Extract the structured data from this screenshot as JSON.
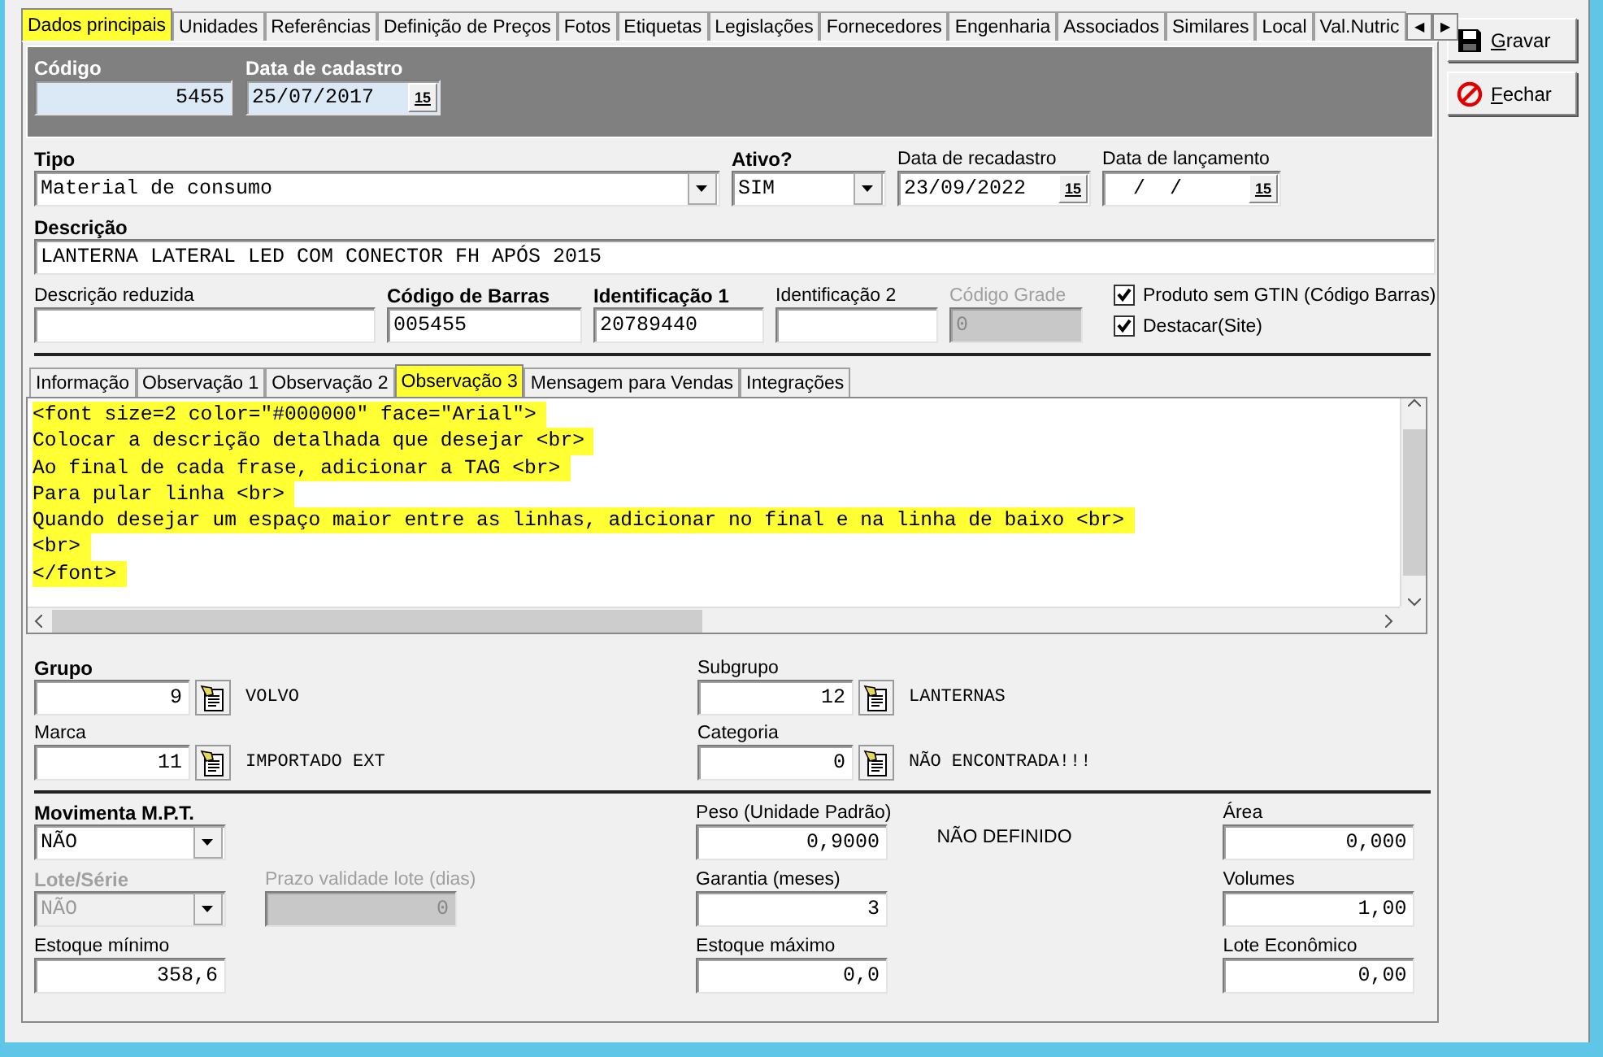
{
  "tabs": [
    {
      "label": "Dados principais",
      "selected": true,
      "highlighted": true
    },
    {
      "label": "Unidades",
      "selected": false,
      "highlighted": false
    },
    {
      "label": "Referências",
      "selected": false,
      "highlighted": false
    },
    {
      "label": "Definição de Preços",
      "selected": false,
      "highlighted": false
    },
    {
      "label": "Fotos",
      "selected": false,
      "highlighted": false
    },
    {
      "label": "Etiquetas",
      "selected": false,
      "highlighted": false
    },
    {
      "label": "Legislações",
      "selected": false,
      "highlighted": false
    },
    {
      "label": "Fornecedores",
      "selected": false,
      "highlighted": false
    },
    {
      "label": "Engenharia",
      "selected": false,
      "highlighted": false
    },
    {
      "label": "Associados",
      "selected": false,
      "highlighted": false
    },
    {
      "label": "Similares",
      "selected": false,
      "highlighted": false
    },
    {
      "label": "Local",
      "selected": false,
      "highlighted": false
    },
    {
      "label": "Val.Nutric",
      "selected": false,
      "highlighted": false
    }
  ],
  "tab_scroll": [
    "◀",
    "▶"
  ],
  "header": {
    "fields": [
      {
        "kind": "number",
        "label": "Código",
        "bold": true,
        "value": "5455"
      },
      {
        "kind": "date",
        "label": "Data de cadastro",
        "bold": true,
        "value": "25/07/2017",
        "button_label": "15"
      }
    ]
  },
  "general": {
    "fields": [
      {
        "kind": "select",
        "label": "Tipo",
        "bold": true,
        "value": "Material de consumo"
      },
      {
        "kind": "select",
        "label": "Ativo?",
        "bold": true,
        "value": "SIM"
      },
      {
        "kind": "date",
        "label": "Data de recadastro",
        "bold": false,
        "value": "23/09/2022",
        "button_label": "15"
      },
      {
        "kind": "date",
        "label": "Data de lançamento",
        "bold": false,
        "value": "  /  /",
        "button_label": "15"
      },
      {
        "kind": "text",
        "label": "Descrição",
        "bold": true,
        "value": "LANTERNA LATERAL LED COM CONECTOR FH APÓS 2015"
      },
      {
        "kind": "text",
        "label": "Descrição reduzida",
        "bold": false
      },
      {
        "kind": "text",
        "label": "Código de Barras",
        "bold": true,
        "value": "005455"
      },
      {
        "kind": "text",
        "label": "Identificação 1",
        "bold": true,
        "value": "20789440"
      },
      {
        "kind": "text",
        "label": "Identificação 2",
        "bold": false
      },
      {
        "kind": "text",
        "label": "Código Grade",
        "bold": false,
        "value": "0",
        "disabled": true
      }
    ]
  },
  "options": [
    {
      "label": "Produto sem GTIN (Código Barras)",
      "checked": true
    },
    {
      "label": "Destacar(Site)",
      "checked": true
    }
  ],
  "subtabs": [
    {
      "label": "Informação",
      "selected": false,
      "highlighted": false
    },
    {
      "label": "Observação 1",
      "selected": false,
      "highlighted": false
    },
    {
      "label": "Observação 2",
      "selected": false,
      "highlighted": false
    },
    {
      "label": "Observação 3",
      "selected": true,
      "highlighted": true
    },
    {
      "label": "Mensagem para Vendas",
      "selected": false,
      "highlighted": false
    },
    {
      "label": "Integrações",
      "selected": false,
      "highlighted": false
    }
  ],
  "memo": {
    "lines": [
      {
        "text": "<font size=2 color=\"#000000\" face=\"Arial\">",
        "highlighted": true
      },
      {
        "text": "Colocar a descrição detalhada que desejar <br>",
        "highlighted": true
      },
      {
        "text": "Ao final de cada frase, adicionar a TAG <br>",
        "highlighted": true
      },
      {
        "text": "Para pular linha <br>",
        "highlighted": true
      },
      {
        "text": "Quando desejar um espaço maior entre as linhas, adicionar no final e na linha de baixo <br>",
        "highlighted": true
      },
      {
        "text": "<br>",
        "highlighted": true
      },
      {
        "text": "</font>",
        "highlighted": true
      }
    ]
  },
  "classification": {
    "columns": [
      [
        {
          "kind": "lookup",
          "label": "Grupo",
          "bold": true,
          "value": "9",
          "name": "VOLVO"
        },
        {
          "kind": "lookup",
          "label": "Marca",
          "bold": false,
          "value": "11",
          "name": "IMPORTADO EXT"
        }
      ],
      [
        {
          "kind": "lookup",
          "label": "Subgrupo",
          "bold": false,
          "value": "12",
          "name": "LANTERNAS"
        },
        {
          "kind": "lookup",
          "label": "Categoria",
          "bold": false,
          "value": "0",
          "name": "NÃO ENCONTRADA!!!"
        }
      ]
    ]
  },
  "stock": {
    "columns": [
      [
        [
          {
            "kind": "select",
            "label": "Movimenta M.P.T.",
            "bold": true,
            "value": "NÃO"
          }
        ],
        [
          {
            "kind": "select",
            "label": "Lote/Série",
            "bold": true,
            "value": "NÃO",
            "disabled": true
          },
          {
            "kind": "number",
            "label": "Prazo validade lote (dias)",
            "bold": false,
            "value": "0",
            "disabled": true
          }
        ],
        [
          {
            "kind": "number",
            "label": "Estoque mínimo",
            "bold": false,
            "value": "358,6"
          }
        ]
      ],
      [
        [
          {
            "kind": "number",
            "label": "Peso (Unidade Padrão)",
            "bold": false,
            "value": "0,9000",
            "note": "NÃO DEFINIDO"
          }
        ],
        [
          {
            "kind": "number",
            "label": "Garantia (meses)",
            "bold": false,
            "value": "3"
          }
        ],
        [
          {
            "kind": "number",
            "label": "Estoque máximo",
            "bold": false,
            "value": "0,0"
          }
        ]
      ],
      [
        [
          {
            "kind": "number",
            "label": "Área",
            "bold": false,
            "value": "0,000"
          }
        ],
        [
          {
            "kind": "number",
            "label": "Volumes",
            "bold": false,
            "value": "1,00"
          }
        ],
        [
          {
            "kind": "number",
            "label": "Lote Econômico",
            "bold": false,
            "value": "0,00"
          }
        ]
      ]
    ]
  },
  "actions": [
    {
      "kind": "save",
      "label": "Gravar"
    },
    {
      "kind": "close",
      "label": "Fechar"
    }
  ]
}
